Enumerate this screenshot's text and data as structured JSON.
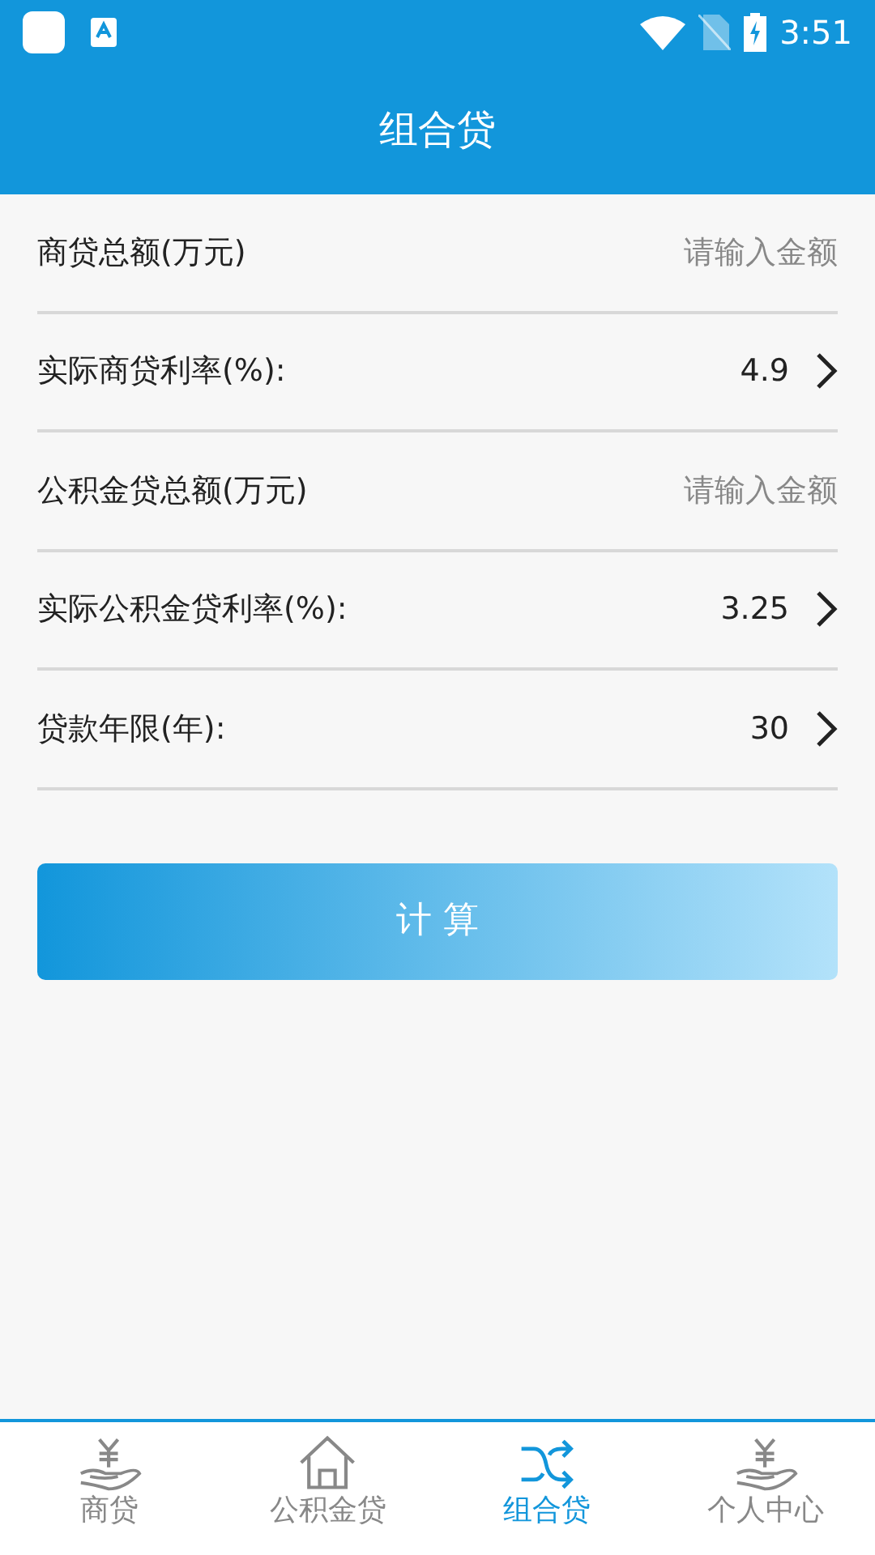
{
  "status_bar": {
    "time": "3:51"
  },
  "header": {
    "title": "组合贷"
  },
  "rows": [
    {
      "kind": "input",
      "label": "商贷总额(万元)",
      "placeholder": "请输入金额"
    },
    {
      "kind": "select",
      "label": "实际商贷利率(%):",
      "value": "4.9"
    },
    {
      "kind": "input",
      "label": "公积金贷总额(万元)",
      "placeholder": "请输入金额"
    },
    {
      "kind": "select",
      "label": "实际公积金贷利率(%):",
      "value": "3.25"
    },
    {
      "kind": "select",
      "label": "贷款年限(年):",
      "value": "30"
    }
  ],
  "button": {
    "label": "计 算"
  },
  "bottom_nav": [
    {
      "label": "商贷",
      "kind": "hand",
      "selected": false
    },
    {
      "label": "公积金贷",
      "kind": "house",
      "selected": false
    },
    {
      "label": "组合贷",
      "kind": "shuffle",
      "selected": true
    },
    {
      "label": "个人中心",
      "kind": "hand",
      "selected": false
    }
  ]
}
